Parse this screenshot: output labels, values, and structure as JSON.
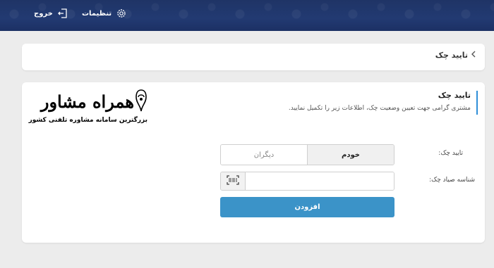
{
  "header": {
    "settings_label": "تنظیمات",
    "settings_icon": "gear-icon",
    "logout_label": "خروج",
    "logout_icon": "logout-icon"
  },
  "breadcrumb": {
    "label": "تایید چک",
    "icon": "chevron-left-icon"
  },
  "section": {
    "title": "تایید چک",
    "description": "مشتری گرامی جهت تعیین وضعیت چک، اطلاعات زیر را تکمیل نمایید."
  },
  "watermark": {
    "brand": "همراه مشاور",
    "tagline": "بزرگترین سامانه مشاوره تلفنی کشور"
  },
  "form": {
    "confirm_label": "تایید چک:",
    "toggle_self": "خودم",
    "toggle_other": "دیگران",
    "toggle_selected": "خودم",
    "sayad_label": "شناسه صیاد چک:",
    "sayad_value": "",
    "scan_icon": "barcode-scan-icon",
    "submit_label": "افزودن"
  },
  "colors": {
    "header_bg": "#223a72",
    "accent": "#2f8fd8",
    "button_bg": "#3b93c8",
    "page_bg": "#ececec"
  }
}
